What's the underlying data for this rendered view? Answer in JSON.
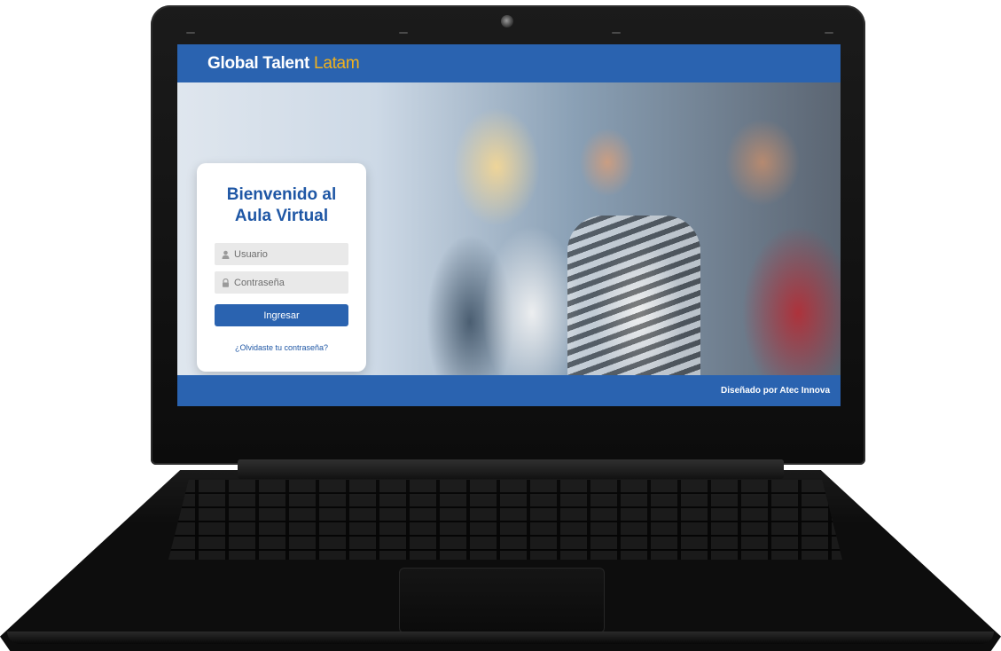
{
  "header": {
    "brand_main": "Global Talent",
    "brand_accent": "Latam"
  },
  "login": {
    "title_line1": "Bienvenido al",
    "title_line2": "Aula Virtual",
    "username_placeholder": "Usuario",
    "password_placeholder": "Contraseña",
    "submit_label": "Ingresar",
    "forgot_label": "¿Olvidaste tu contraseña?"
  },
  "footer": {
    "credit": "Diseñado por Atec Innova"
  },
  "colors": {
    "brand_blue": "#2a63b0",
    "title_blue": "#1f57a5",
    "accent_yellow": "#f2b21c",
    "field_bg": "#e9e9e9"
  },
  "icons": {
    "username": "user-icon",
    "password": "lock-icon",
    "camera": "webcam-icon"
  }
}
